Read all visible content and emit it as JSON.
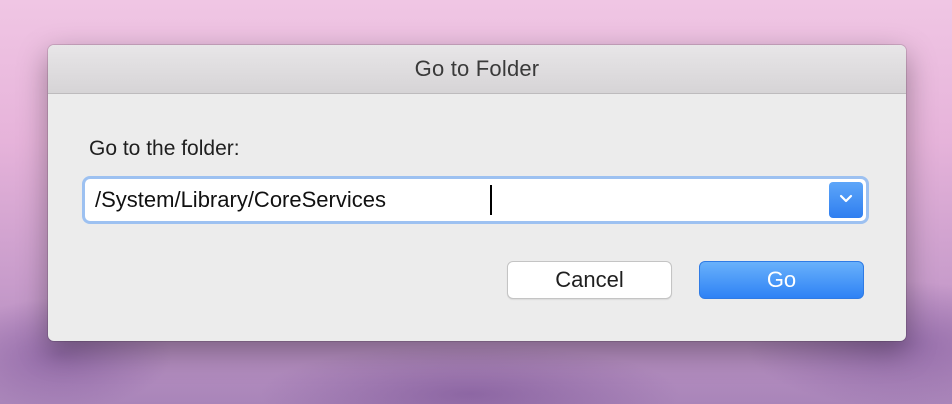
{
  "dialog": {
    "title": "Go to Folder",
    "prompt_label": "Go to the folder:",
    "path_field": {
      "value": "/System/Library/CoreServices"
    },
    "dropdown_icon": "chevron-down-icon",
    "buttons": {
      "cancel_label": "Cancel",
      "go_label": "Go"
    }
  },
  "colors": {
    "accent": "#2e82f5",
    "focus_ring": "#9dc1f1",
    "dialog_bg": "#ececec"
  }
}
